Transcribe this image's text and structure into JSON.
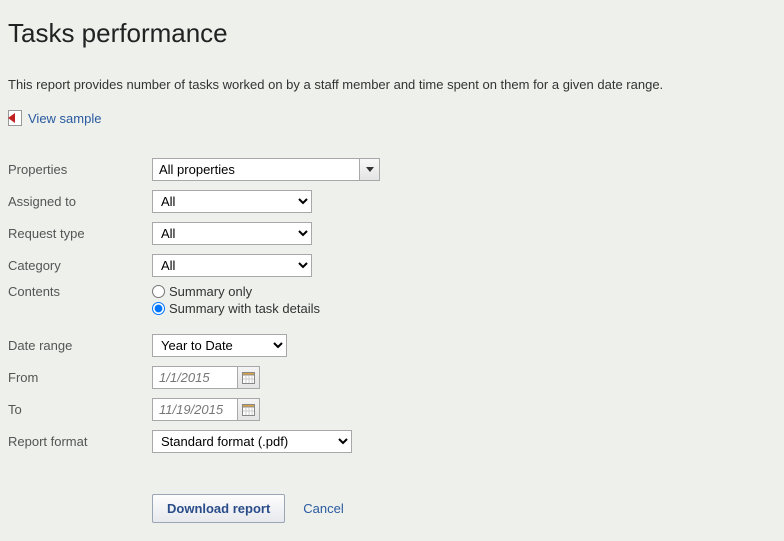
{
  "header": {
    "title": "Tasks performance"
  },
  "description": "This report provides number of tasks worked on by a staff member and time spent on them for a given date range.",
  "view_sample": {
    "label": "View sample"
  },
  "form": {
    "properties": {
      "label": "Properties",
      "value": "All properties"
    },
    "assigned_to": {
      "label": "Assigned to",
      "value": "All"
    },
    "request_type": {
      "label": "Request type",
      "value": "All"
    },
    "category": {
      "label": "Category",
      "value": "All"
    },
    "contents": {
      "label": "Contents",
      "options": {
        "summary_only": "Summary only",
        "summary_details": "Summary with task details"
      },
      "selected": "summary_details"
    },
    "date_range": {
      "label": "Date range",
      "value": "Year to Date"
    },
    "from": {
      "label": "From",
      "value": "1/1/2015"
    },
    "to": {
      "label": "To",
      "value": "11/19/2015"
    },
    "report_format": {
      "label": "Report format",
      "value": "Standard format (.pdf)"
    }
  },
  "actions": {
    "download": "Download report",
    "cancel": "Cancel"
  }
}
